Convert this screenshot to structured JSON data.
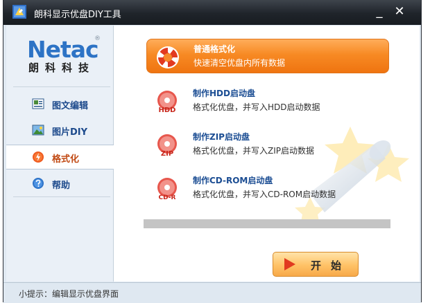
{
  "window": {
    "title": "朗科显示优盘DIY工具",
    "minimize_label": "_",
    "close_label": "✕"
  },
  "logo": {
    "brand": "Netac",
    "registered": "®",
    "cn_name": "朗科科技"
  },
  "sidebar": {
    "items": [
      {
        "label": "图文编辑",
        "icon": "text-image-edit-icon",
        "active": false
      },
      {
        "label": "图片DIY",
        "icon": "picture-icon",
        "active": false
      },
      {
        "label": "格式化",
        "icon": "format-icon",
        "active": true
      },
      {
        "label": "帮助",
        "icon": "help-icon",
        "active": false
      }
    ]
  },
  "options": [
    {
      "title": "普通格式化",
      "desc": "快速清空优盘内所有数据",
      "icon": "lifebuoy-icon",
      "selected": true
    },
    {
      "title": "制作HDD启动盘",
      "desc": "格式化优盘，并写入HDD启动数据",
      "icon": "hdd-disc-icon",
      "badge": "HDD",
      "selected": false
    },
    {
      "title": "制作ZIP启动盘",
      "desc": "格式化优盘，并写入ZIP启动数据",
      "icon": "zip-disc-icon",
      "badge": "ZIP",
      "selected": false
    },
    {
      "title": "制作CD-ROM启动盘",
      "desc": "格式化优盘，并写入CD-ROM启动数据",
      "icon": "cdrom-disc-icon",
      "badge": "CD-R",
      "selected": false
    }
  ],
  "progress": {
    "value": 0
  },
  "start_button": {
    "label": "开始"
  },
  "status": {
    "text": "小提示：编辑显示优盘界面"
  },
  "colors": {
    "accent": "#f7892a",
    "title_blue": "#1b4d93",
    "titlebar": "#25292f"
  }
}
